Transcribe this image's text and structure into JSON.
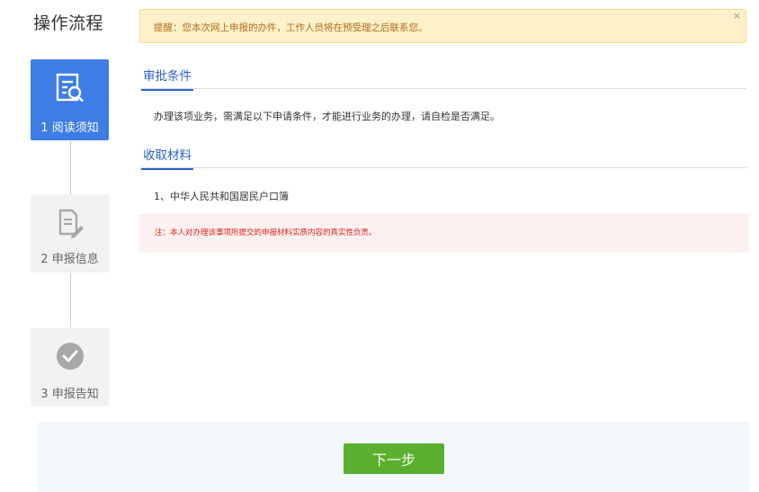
{
  "sidebar": {
    "title": "操作流程",
    "steps": [
      {
        "label": "1 阅读须知",
        "icon": "document-search-icon",
        "state": "active"
      },
      {
        "label": "2 申报信息",
        "icon": "document-edit-icon",
        "state": "inactive"
      },
      {
        "label": "3 申报告知",
        "icon": "check-circle-icon",
        "state": "inactive"
      }
    ]
  },
  "alert": {
    "text": "提醒：您本次网上申报的办件，工作人员将在预受理之后联系您。",
    "close_label": "×"
  },
  "sections": {
    "conditions": {
      "title": "审批条件",
      "text": "办理该项业务，需满足以下申请条件，才能进行业务的办理，请自检是否满足。"
    },
    "materials": {
      "title": "收取材料",
      "items": [
        "1、中华人民共和国居民户口簿"
      ],
      "note": "注：本人对办理该事项所提交的申报材料实质内容的真实性负责。"
    }
  },
  "footer": {
    "next_label": "下一步"
  },
  "colors": {
    "accent_blue": "#3e7ce6",
    "link_blue": "#2a62c9",
    "button_green": "#5ab02e",
    "alert_bg": "#fcf1c9",
    "note_red": "#e0251b"
  }
}
